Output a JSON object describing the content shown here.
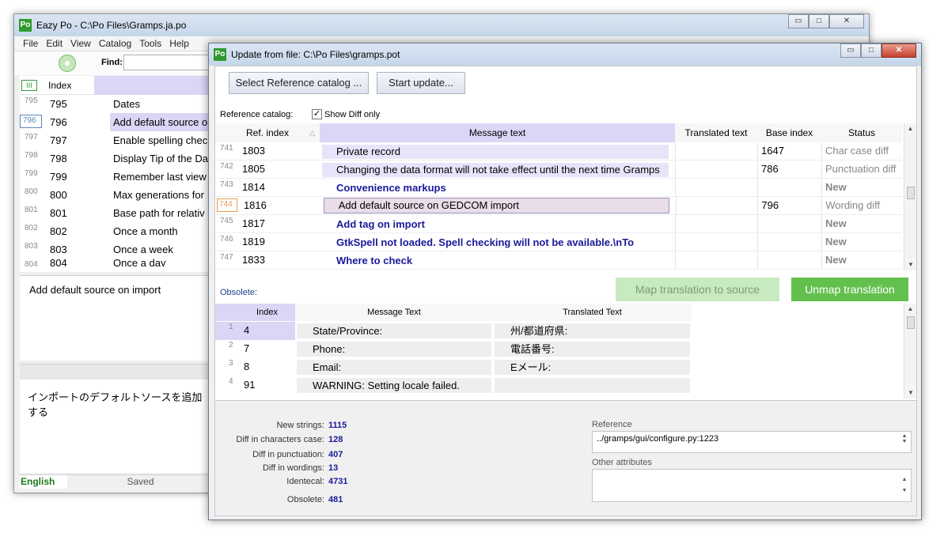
{
  "main_window": {
    "title": "Eazy Po - C:\\Po Files\\Gramps.ja.po",
    "app_icon": "Po",
    "menu": [
      "File",
      "Edit",
      "View",
      "Catalog",
      "Tools",
      "Help"
    ],
    "find_label": "Find:",
    "grid_header_index": "Index",
    "rows": [
      {
        "rownum": "795",
        "index": "795",
        "msg": "Dates"
      },
      {
        "rownum": "796",
        "index": "796",
        "msg": "Add default source o"
      },
      {
        "rownum": "797",
        "index": "797",
        "msg": "Enable spelling chec"
      },
      {
        "rownum": "798",
        "index": "798",
        "msg": "Display Tip of the Da"
      },
      {
        "rownum": "799",
        "index": "799",
        "msg": "Remember last view"
      },
      {
        "rownum": "800",
        "index": "800",
        "msg": "Max generations for"
      },
      {
        "rownum": "801",
        "index": "801",
        "msg": "Base path for relativ"
      },
      {
        "rownum": "802",
        "index": "802",
        "msg": "Once a month"
      },
      {
        "rownum": "803",
        "index": "803",
        "msg": "Once a week"
      },
      {
        "rownum": "804",
        "index": "804",
        "msg": "Once a day"
      }
    ],
    "source_text": "Add default source on import",
    "translation_text": "インポートのデフォルトソースを追加する",
    "status_language": "English",
    "status_saved": "Saved"
  },
  "dialog": {
    "title": "Update from file: C:\\Po Files\\gramps.pot",
    "app_icon": "Po",
    "select_ref_button": "Select Reference catalog ...",
    "start_update_button": "Start update...",
    "reference_catalog_label": "Reference catalog:",
    "show_diff_label": "Show Diff only",
    "show_diff_checked": true,
    "headers": {
      "ref_index": "Ref. index",
      "message_text": "Message text",
      "translated_text": "Translated text",
      "base_index": "Base index",
      "status": "Status"
    },
    "rows": [
      {
        "rownum": "741",
        "ref": "1803",
        "msg": "Private record",
        "trans": "",
        "base": "1647",
        "status": "Char case diff",
        "style": "shade"
      },
      {
        "rownum": "742",
        "ref": "1805",
        "msg": "Changing the data format will not take effect until the next time Gramps",
        "trans": "",
        "base": "786",
        "status": "Punctuation diff",
        "style": "shade"
      },
      {
        "rownum": "743",
        "ref": "1814",
        "msg": "Convenience markups",
        "trans": "",
        "base": "",
        "status": "New",
        "style": "bold"
      },
      {
        "rownum": "744",
        "ref": "1816",
        "msg": "Add default source on GEDCOM import",
        "trans": "",
        "base": "796",
        "status": "Wording diff",
        "style": "pink"
      },
      {
        "rownum": "745",
        "ref": "1817",
        "msg": "Add tag on import",
        "trans": "",
        "base": "",
        "status": "New",
        "style": "bold"
      },
      {
        "rownum": "746",
        "ref": "1819",
        "msg": "GtkSpell not loaded. Spell checking will not be available.\\nTo",
        "trans": "",
        "base": "",
        "status": "New",
        "style": "bold"
      },
      {
        "rownum": "747",
        "ref": "1833",
        "msg": "Where to check",
        "trans": "",
        "base": "",
        "status": "New",
        "style": "bold"
      }
    ],
    "obsolete_label": "Obsolete:",
    "map_button": "Map translation to source",
    "unmap_button": "Unmap translation",
    "obsolete_headers": {
      "index": "Index",
      "message_text": "Message Text",
      "translated_text": "Translated Text"
    },
    "obsolete_rows": [
      {
        "rownum": "1",
        "index": "4",
        "msg": "State/Province:",
        "trans": "州/都道府県:"
      },
      {
        "rownum": "2",
        "index": "7",
        "msg": "Phone:",
        "trans": "電話番号:"
      },
      {
        "rownum": "3",
        "index": "8",
        "msg": "Email:",
        "trans": "Eメール:"
      },
      {
        "rownum": "4",
        "index": "91",
        "msg": "WARNING: Setting locale failed.",
        "trans": ""
      }
    ],
    "stats": [
      {
        "label": "New strings:",
        "value": "1115"
      },
      {
        "label": "Diff in characters case:",
        "value": "128"
      },
      {
        "label": "Diff in punctuation:",
        "value": "407"
      },
      {
        "label": "Diff in wordings:",
        "value": "13"
      },
      {
        "label": "Identecal:",
        "value": "4731"
      },
      {
        "label": "Obsolete:",
        "value": "481"
      }
    ],
    "reference_label": "Reference",
    "reference_value": "../gramps/gui/configure.py:1223",
    "other_attributes_label": "Other attributes"
  }
}
